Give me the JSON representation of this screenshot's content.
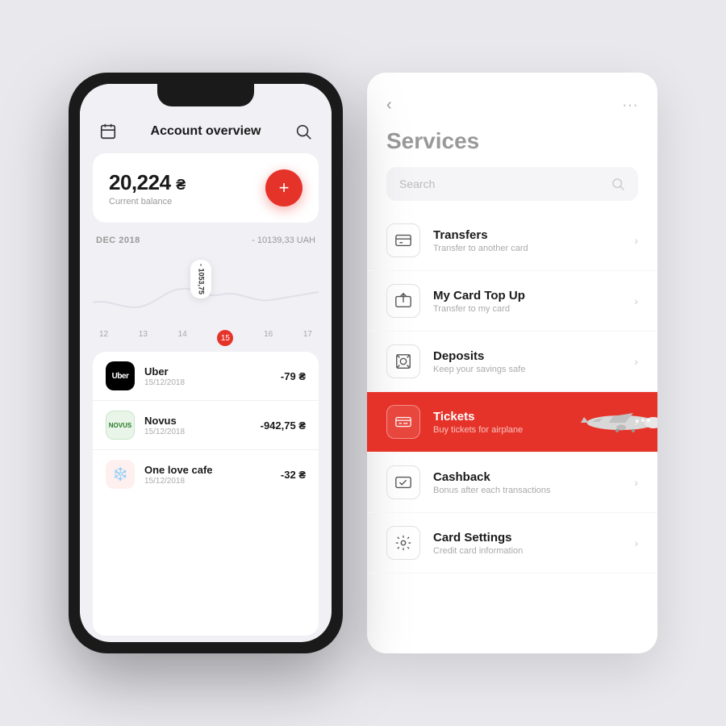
{
  "phone": {
    "header": {
      "title": "Account overview",
      "calendar_icon": "calendar-icon",
      "search_icon": "search-icon"
    },
    "balance": {
      "amount": "20,224",
      "currency": "₴",
      "label": "Current balance",
      "add_button": "+"
    },
    "period": {
      "label": "DEC 2018",
      "amount": "- 10139,33 UAH"
    },
    "chart": {
      "tooltip": "- 1053,75",
      "dates": [
        "12",
        "13",
        "14",
        "15",
        "16",
        "17"
      ],
      "active_date": "15"
    },
    "transactions": [
      {
        "name": "Uber",
        "date": "15/12/2018",
        "amount": "-79 ₴",
        "logo_type": "uber"
      },
      {
        "name": "Novus",
        "date": "15/12/2018",
        "amount": "-942,75 ₴",
        "logo_type": "novus"
      },
      {
        "name": "One love cafe",
        "date": "15/12/2018",
        "amount": "-32 ₴",
        "logo_type": "onelove"
      }
    ]
  },
  "services": {
    "back_label": "‹",
    "more_label": "⋯",
    "title": "Services",
    "search_placeholder": "Search",
    "items": [
      {
        "name": "Transfers",
        "desc": "Transfer to another card",
        "icon": "transfers-icon",
        "active": false
      },
      {
        "name": "My Card Top Up",
        "desc": "Transfer to my card",
        "icon": "topup-icon",
        "active": false
      },
      {
        "name": "Deposits",
        "desc": "Keep your savings safe",
        "icon": "deposits-icon",
        "active": false
      },
      {
        "name": "Tickets",
        "desc": "Buy tickets for airplane",
        "icon": "tickets-icon",
        "active": true
      },
      {
        "name": "Cashback",
        "desc": "Bonus after each transactions",
        "icon": "cashback-icon",
        "active": false
      },
      {
        "name": "Card Settings",
        "desc": "Credit card information",
        "icon": "card-settings-icon",
        "active": false
      }
    ]
  }
}
